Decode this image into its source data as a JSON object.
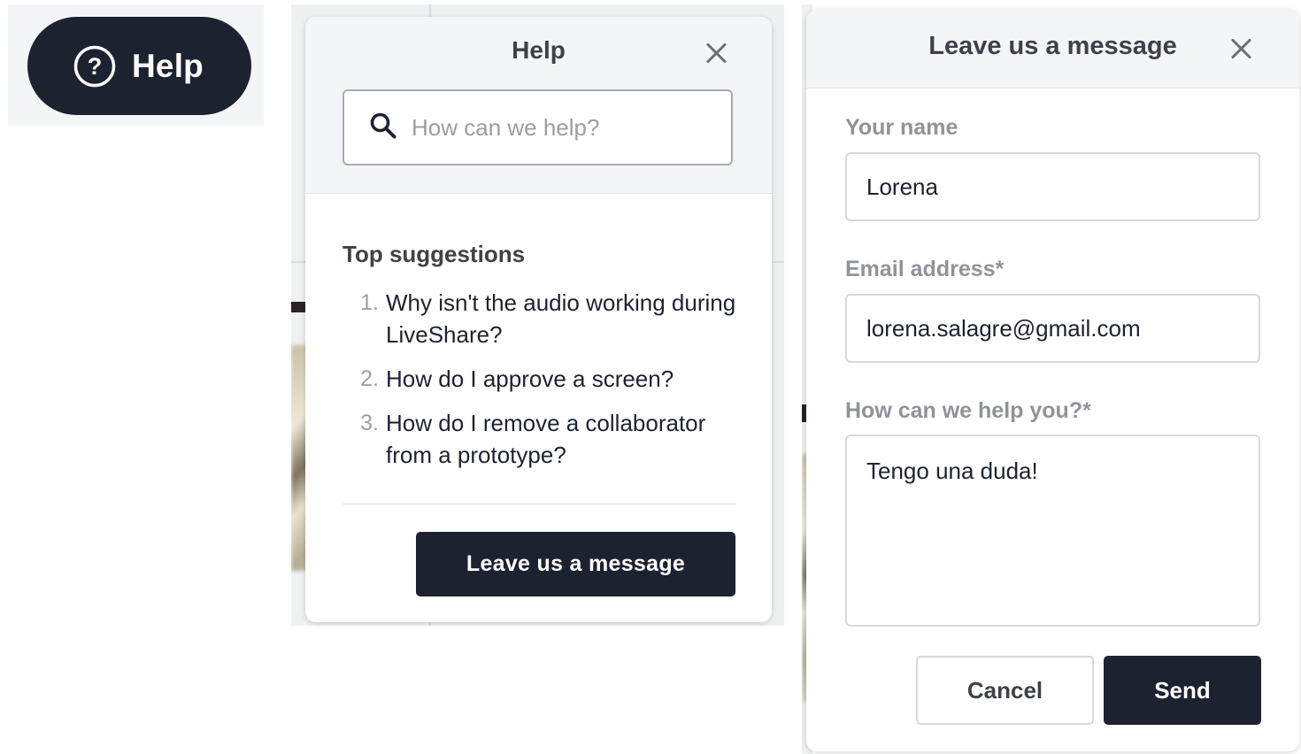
{
  "launcher": {
    "label": "Help",
    "icon": "question-circle-icon"
  },
  "help_widget": {
    "title": "Help",
    "search_placeholder": "How can we help?",
    "suggestions_title": "Top suggestions",
    "suggestions": [
      {
        "num": "1.",
        "text": "Why isn't the audio working during LiveShare?"
      },
      {
        "num": "2.",
        "text": "How do I approve a screen?"
      },
      {
        "num": "3.",
        "text": "How do I remove a collaborator from a prototype?"
      }
    ],
    "leave_message_label": "Leave us a message"
  },
  "message_widget": {
    "title": "Leave us a message",
    "name_label": "Your name",
    "name_value": "Lorena",
    "email_label": "Email address*",
    "email_value": "lorena.salagre@gmail.com",
    "help_label": "How can we help you?*",
    "help_value": "Tengo una duda!",
    "cancel_label": "Cancel",
    "send_label": "Send"
  },
  "colors": {
    "dark": "#1d2230",
    "panel_header": "#f4f5f7",
    "muted_label": "#8f939a"
  }
}
